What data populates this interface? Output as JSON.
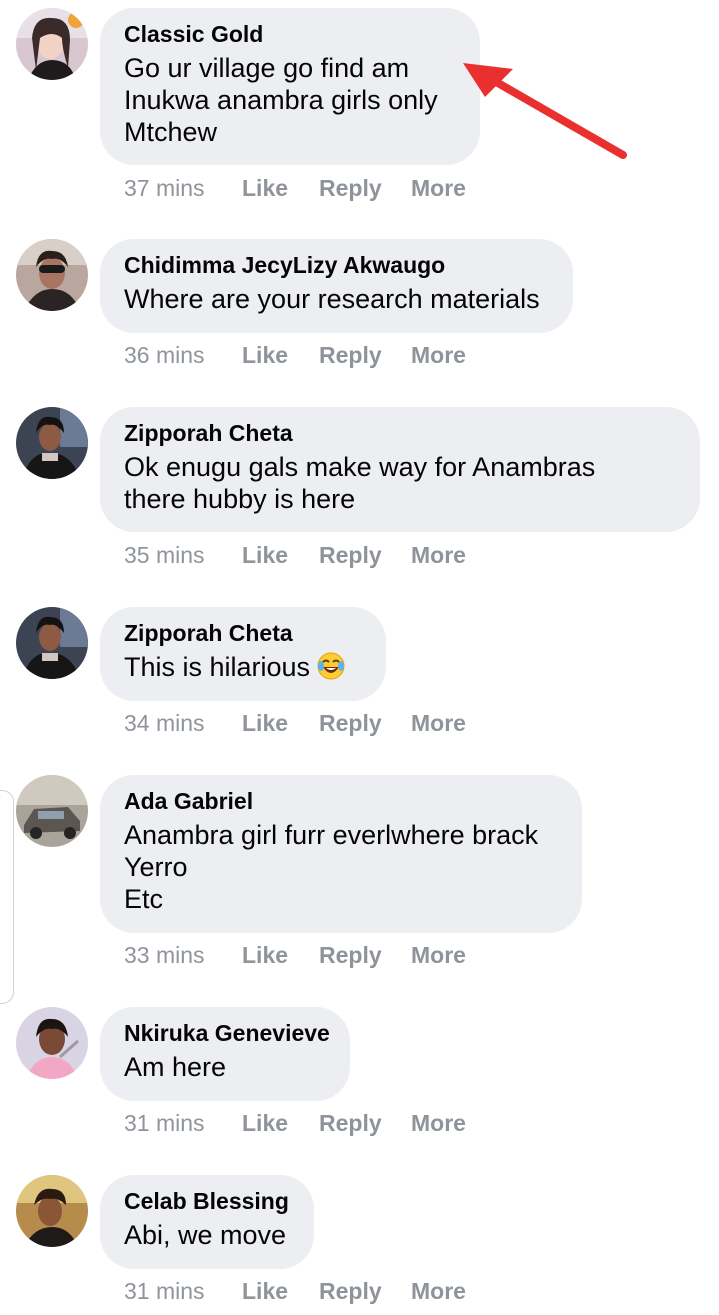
{
  "comments": [
    {
      "author": "Classic Gold",
      "text": "Go ur village go find am\nInukwa anambra girls only\nMtchew",
      "time": "37 mins",
      "like": "Like",
      "reply": "Reply",
      "more": "More"
    },
    {
      "author": "Chidimma JecyLizy Akwaugo",
      "text": "Where are your research materials",
      "time": "36 mins",
      "like": "Like",
      "reply": "Reply",
      "more": "More"
    },
    {
      "author": "Zipporah Cheta",
      "text": "Ok enugu gals make way for Anambras\nthere hubby is here",
      "time": "35 mins",
      "like": "Like",
      "reply": "Reply",
      "more": "More"
    },
    {
      "author": "Zipporah Cheta",
      "text": "This is hilarious",
      "emoji": "laughing-tears",
      "time": "34 mins",
      "like": "Like",
      "reply": "Reply",
      "more": "More"
    },
    {
      "author": "Ada Gabriel",
      "text": "Anambra girl furr everlwhere brack\nYerro\nEtc",
      "time": "33 mins",
      "like": "Like",
      "reply": "Reply",
      "more": "More"
    },
    {
      "author": "Nkiruka Genevieve",
      "text": "Am here",
      "time": "31 mins",
      "like": "Like",
      "reply": "Reply",
      "more": "More"
    },
    {
      "author": "Celab Blessing",
      "text": "Abi, we move",
      "time": "31 mins",
      "like": "Like",
      "reply": "Reply",
      "more": "More"
    }
  ],
  "colors": {
    "bubble": "#eceef1",
    "action_text": "#8f949b",
    "name_text": "#050505",
    "arrow": "#ea2f2f"
  },
  "annotation": {
    "icon": "red-arrow-icon"
  }
}
